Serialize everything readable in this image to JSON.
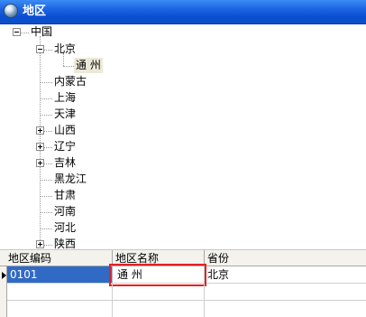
{
  "window": {
    "title": "地区"
  },
  "tree": {
    "root": "中国",
    "beijing": "北京",
    "tongzhou": "通 州",
    "neimenggu": "内蒙古",
    "shanghai": "上海",
    "tianjin": "天津",
    "shanxi": "山西",
    "liaoning": "辽宁",
    "jilin": "吉林",
    "heilongjiang": "黑龙江",
    "gansu": "甘肃",
    "henan": "河南",
    "hebei": "河北",
    "shaanxi": "陕西"
  },
  "grid": {
    "headers": [
      "地区编码",
      "地区名称",
      "省份"
    ],
    "row": {
      "code": "0101",
      "name": "通 州",
      "province": "北京"
    },
    "colors": {
      "selected_row": "#316ac5",
      "highlight_box": "#e32121"
    }
  }
}
